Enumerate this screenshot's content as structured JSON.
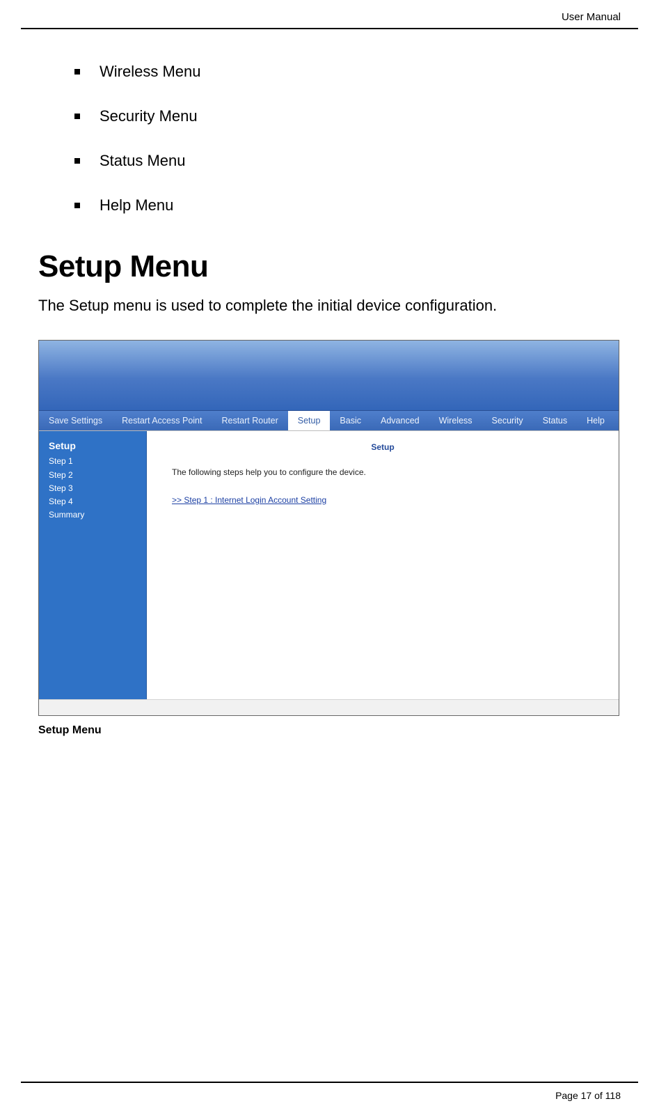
{
  "header": {
    "label": "User Manual"
  },
  "bullets": [
    "Wireless Menu",
    "Security Menu",
    "Status Menu",
    "Help Menu"
  ],
  "section": {
    "title": "Setup Menu",
    "lead": "The Setup menu is used to complete the initial device configuration."
  },
  "screenshot": {
    "toolbar_links": [
      "Save Settings",
      "Restart Access Point",
      "Restart Router"
    ],
    "tabs": [
      "Setup",
      "Basic",
      "Advanced",
      "Wireless",
      "Security",
      "Status",
      "Help"
    ],
    "active_tab": "Setup",
    "sidebar": {
      "title": "Setup",
      "items": [
        "Step 1",
        "Step 2",
        "Step 3",
        "Step 4",
        "Summary"
      ]
    },
    "panel": {
      "title": "Setup",
      "description": "The following steps help you to configure the device.",
      "step_link": ">> Step 1 : Internet Login Account Setting"
    }
  },
  "caption": "Setup Menu",
  "footer": {
    "page": "Page 17 of 118"
  }
}
